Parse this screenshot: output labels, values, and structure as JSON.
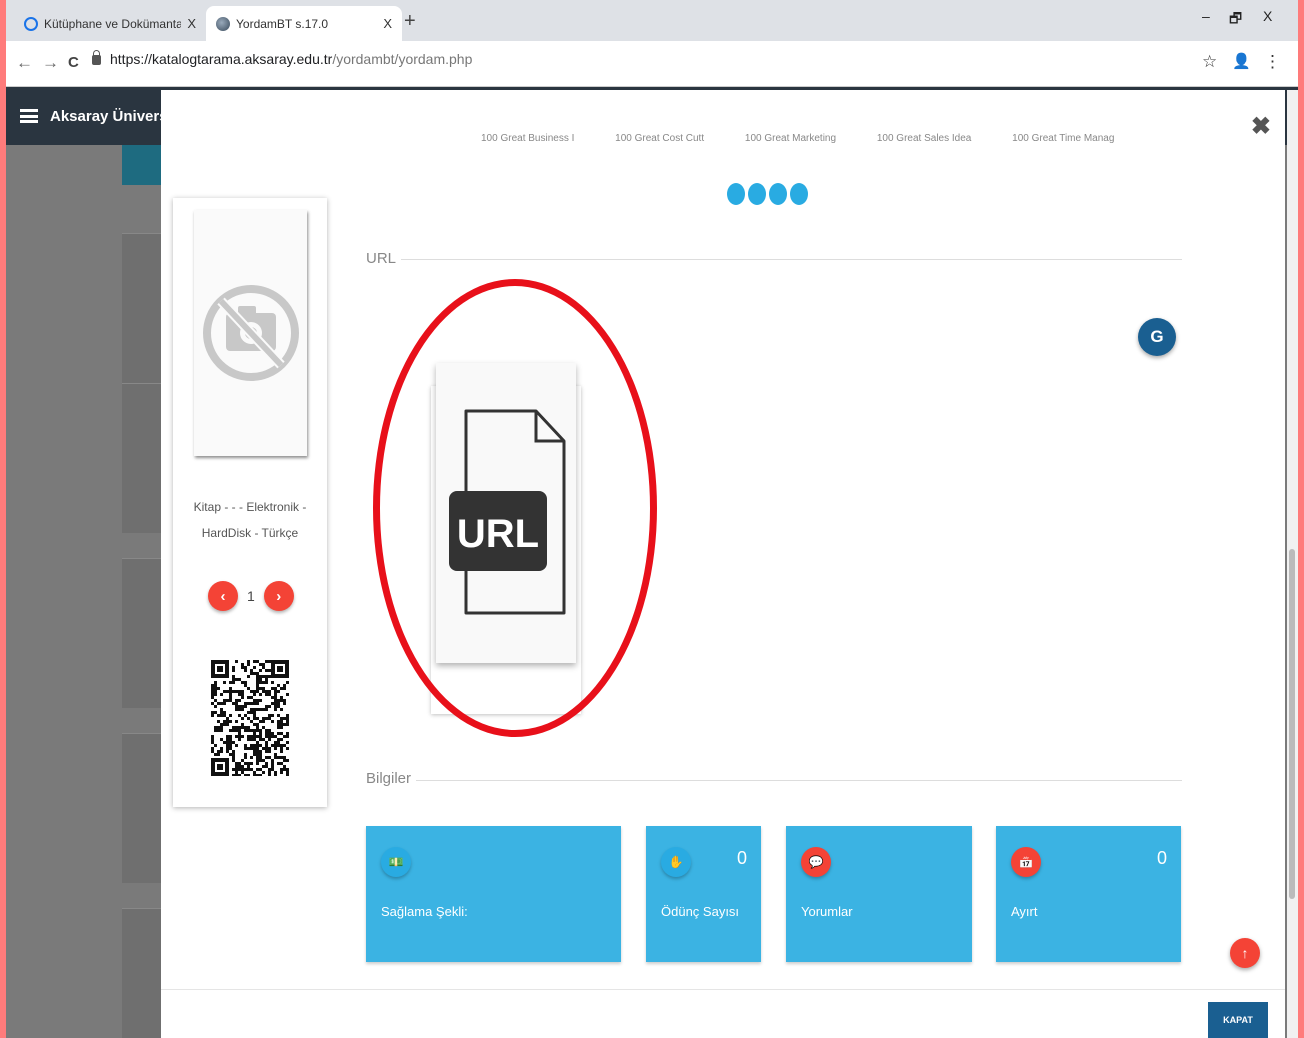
{
  "browser": {
    "tabs": [
      {
        "title": "Kütüphane ve Dokümantasyon D",
        "close": "X"
      },
      {
        "title": "YordamBT s.17.0",
        "close": "X"
      }
    ],
    "new_tab": "+",
    "window_controls": {
      "minimize": "–",
      "restore": "🗗",
      "close": "X"
    },
    "url_scheme_host": "https://katalogtarama.aksaray.edu.tr",
    "url_path": "/yordambt/yordam.php",
    "nav": {
      "back": "←",
      "forward": "→",
      "reload": "C"
    },
    "icons": {
      "star": "☆",
      "profile": "👤",
      "menu": "⋮"
    }
  },
  "background_page": {
    "title": "Aksaray Üniversitesi Mer"
  },
  "modal": {
    "close_symbol": "✖",
    "carousel_captions": [
      "100 Great Business I",
      "100 Great Cost Cutt",
      "100 Great Marketing",
      "100 Great Sales Idea",
      "100 Great Time Manag"
    ],
    "item": {
      "description_line1": "Kitap - - - Elektronik -",
      "description_line2": "HardDisk - Türkçe",
      "page_number": "1",
      "prev": "‹",
      "next": "›"
    },
    "url_section_label": "URL",
    "url_badge_text": "URL",
    "g_button": "G",
    "info_section_label": "Bilgiler",
    "info_boxes": [
      {
        "label": "Sağlama Şekli:",
        "value": "",
        "icon": "money-icon"
      },
      {
        "label": "Ödünç Sayısı",
        "value": "0",
        "icon": "hand-icon"
      },
      {
        "label": "Yorumlar",
        "value": "",
        "icon": "comments-icon"
      },
      {
        "label": "Ayırt",
        "value": "0",
        "icon": "calendar-icon"
      }
    ],
    "kapat_label": "KAPAT",
    "up_arrow": "↑"
  },
  "colors": {
    "info_box": "#3bb3e3",
    "accent_red": "#f44336",
    "dark_blue": "#1a5f91",
    "annotation_red": "#e8101a"
  }
}
